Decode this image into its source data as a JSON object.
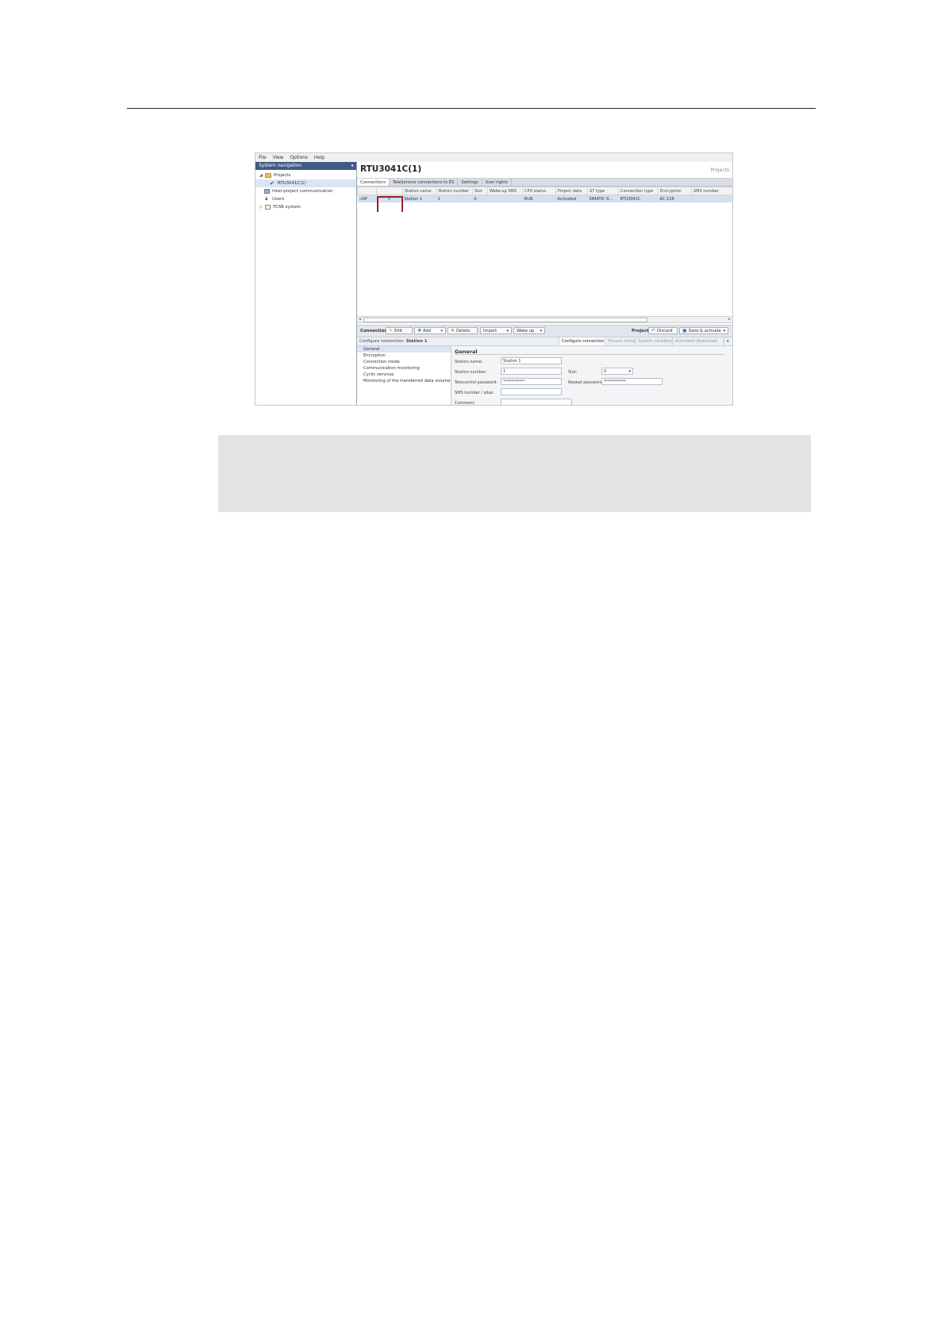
{
  "menu": [
    "File",
    "View",
    "Options",
    "Help"
  ],
  "sidebar": {
    "title": "System navigation",
    "collapse_glyph": "◂",
    "tree": [
      {
        "label": "Projects",
        "icon": "folder-icon"
      },
      {
        "label": "RTU3041C(1)",
        "icon": "check-icon"
      },
      {
        "label": "Inter-project communication",
        "icon": "grid-icon"
      },
      {
        "label": "Users",
        "icon": "users-icon"
      },
      {
        "label": "TCSB system",
        "icon": "system-icon"
      }
    ]
  },
  "main": {
    "title": "RTU3041C(1)",
    "crumb": "Projects",
    "tabs": [
      "Connections",
      "TeleService connections to ES",
      "Settings",
      "User rights"
    ],
    "columns": [
      "",
      "",
      "Station name",
      "Station number",
      "Slot",
      "Wake-up SMS",
      "CPU status",
      "Project data",
      "S7 type",
      "Connection type",
      "Encryption",
      "SMS number"
    ],
    "row": {
      "state": "⇥SP",
      "tick": "✔",
      "station_name": "Station 1",
      "station_number": "1",
      "slot": "0",
      "wake_up_sms": "",
      "cpu_status": "RUN",
      "project_data": "Activated",
      "s7_type": "SIMATIC R...",
      "connection_type": "RTU3041C",
      "encryption": "AC-128",
      "sms_number": ""
    }
  },
  "toolbar": {
    "connection_label": "Connection",
    "edit": "Edit",
    "add": "Add",
    "delete": "Delete",
    "import": "Import",
    "wake_up": "Wake up",
    "project_label": "Project",
    "discard": "Discard",
    "save_activate": "Save & activate"
  },
  "config": {
    "title_prefix": "Configure connection: ",
    "title_station": "Station 1",
    "tabs": [
      "Configure connection",
      "Process items",
      "System variables",
      "Activated (download)"
    ],
    "nav": [
      "General",
      "Encryption",
      "Connection mode",
      "Communication monitoring",
      "Cyclic services",
      "Monitoring of the transferred data volume"
    ],
    "section": "General",
    "fields": {
      "station_name_label": "Station name:",
      "station_name_value": "Station 1",
      "station_number_label": "Station number:",
      "station_number_value": "1",
      "slot_label": "Slot:",
      "slot_value": "0",
      "telecontrol_password_label": "Telecontrol password:",
      "telecontrol_password_value": "***********",
      "repeat_password_label": "Repeat password:",
      "repeat_password_value": "***********",
      "sms_label": "SMS number / alias:",
      "comment_label": "Comment:"
    }
  },
  "colors": {
    "sidebar_header": "#3f5a85",
    "highlight_box": "#9a2222",
    "selection": "#d3e0f2"
  }
}
